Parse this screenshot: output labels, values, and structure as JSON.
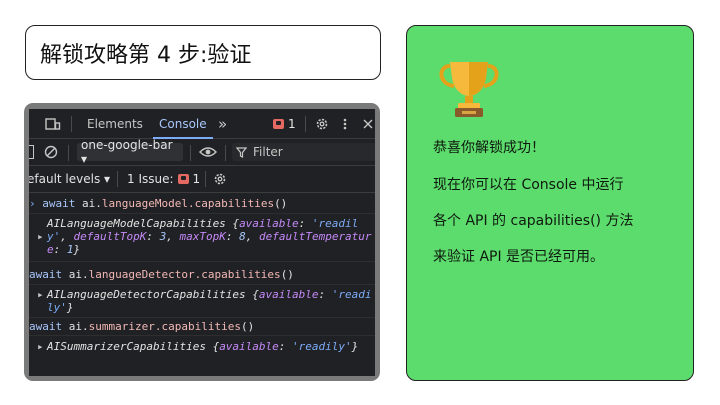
{
  "title": "解锁攻略第 4 步:验证",
  "devtools": {
    "tabs": {
      "elements": "Elements",
      "console": "Console",
      "more": "»"
    },
    "issues_count_top": "1",
    "context_select": "one-google-bar ▾",
    "filter_placeholder": "Filter",
    "levels_select": "efault levels ▾",
    "issues_label": "1 Issue:",
    "issues_count": "1",
    "console": {
      "l1_kw": "await ",
      "l1_obj": "ai.",
      "l1_fn": "languageModel.capabilities",
      "l1_tail": "()",
      "r1_a": "AILanguageModelCapabilities {",
      "r1_b": "available",
      "r1_c": ": ",
      "r1_d": "'readil",
      "r1_e": "y'",
      "r1_f": ", ",
      "r1_g": "defaultTopK",
      "r1_h": ": ",
      "r1_i": "3",
      "r1_j": ", ",
      "r1_k": "maxTopK",
      "r1_l": ": ",
      "r1_m": "8",
      "r1_n": ", ",
      "r1_o": "defaultTemperatur",
      "r1_p": "e",
      "r1_q": ": ",
      "r1_r": "1",
      "r1_s": "}",
      "l2_kw": "await ",
      "l2_obj": "ai.",
      "l2_fn": "languageDetector.capabilities",
      "l2_tail": "()",
      "r2_a": "AILanguageDetectorCapabilities {",
      "r2_b": "available",
      "r2_c": ": ",
      "r2_d": "'readi",
      "r2_e": "ly'",
      "r2_f": "}",
      "l3_kw": "await ",
      "l3_obj": "ai.",
      "l3_fn": "summarizer.capabilities",
      "l3_tail": "()",
      "r3_a": "AISummarizerCapabilities {",
      "r3_b": "available",
      "r3_c": ": ",
      "r3_d": "'readily'",
      "r3_e": "}"
    }
  },
  "message": {
    "line1": "恭喜你解锁成功！",
    "line2": "现在你可以在 Console 中运行",
    "line3": "各个 API 的 capabilities() 方法",
    "line4": "来验证 API 是否已经可用。"
  },
  "colors": {
    "panel_green": "#5cdc6c",
    "devtools_bg": "#202124"
  }
}
